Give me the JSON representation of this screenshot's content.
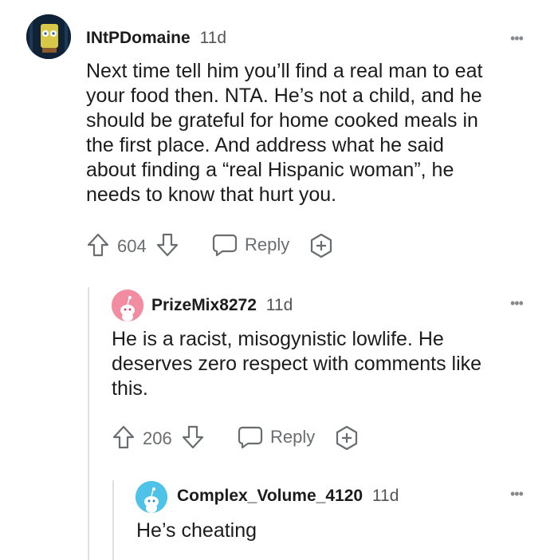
{
  "comments": [
    {
      "username": "INtPDomaine",
      "time": "11d",
      "text": "Next time tell him you’ll find a real man to eat your food then. NTA. He’s not a child, and he should be grateful for home cooked meals in the first place. And address what he said about finding a “real Hispanic woman”, he needs to know that hurt you.",
      "text_lines": [
        "Next time tell him you’ll find a real man to eat",
        "your food then. NTA. He’s not a child, and he",
        "should be grateful for home cooked meals in",
        "the first place. And address what he said",
        "about finding a “real Hispanic woman”, he",
        "needs to know that hurt you."
      ],
      "votes": "604",
      "reply_label": "Reply",
      "more_label": "•••"
    },
    {
      "username": "PrizeMix8272",
      "time": "11d",
      "text_lines": [
        "He is a racist, misogynistic lowlife. He",
        "deserves zero respect with comments like",
        "this."
      ],
      "votes": "206",
      "reply_label": "Reply",
      "more_label": "•••"
    },
    {
      "username": "Complex_Volume_4120",
      "time": "11d",
      "text_lines": [
        "He’s cheating"
      ],
      "more_label": "•••"
    }
  ],
  "icons": {
    "upvote": "arrow-up-icon",
    "downvote": "arrow-down-icon",
    "reply": "speech-bubble-icon",
    "award": "hexagon-plus-icon",
    "more": "more-dots-icon"
  },
  "colors": {
    "avatar2_bg": "#f28ca0",
    "avatar3_bg": "#4fc2e8",
    "thread_line": "#e0e0e0",
    "meta_gray": "#6a6d70"
  }
}
